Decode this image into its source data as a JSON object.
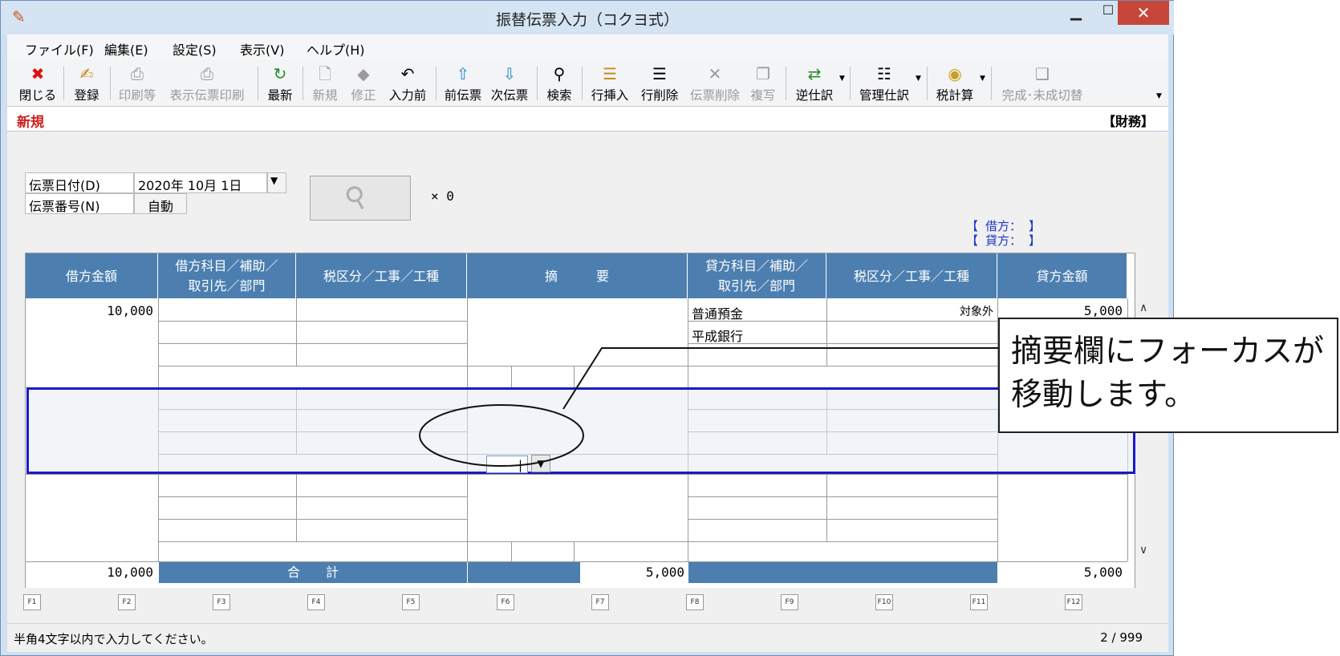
{
  "window": {
    "title": "振替伝票入力（コクヨ式）"
  },
  "menu": [
    "ファイル(F)",
    "編集(E)",
    "設定(S)",
    "表示(V)",
    "ヘルプ(H)"
  ],
  "toolbar": {
    "close": "閉じる",
    "register": "登録",
    "print": "印刷等",
    "print_display": "表示伝票印刷",
    "refresh": "最新",
    "new": "新規",
    "modify": "修正",
    "before_input": "入力前",
    "prev_slip": "前伝票",
    "next_slip": "次伝票",
    "search": "検索",
    "row_insert": "行挿入",
    "row_delete": "行削除",
    "slip_delete": "伝票削除",
    "copy": "複写",
    "reverse": "逆仕訳",
    "manage": "管理仕訳",
    "tax_calc": "税計算",
    "complete": "完成･未成切替"
  },
  "mode": {
    "status": "新規",
    "category": "【財務】"
  },
  "header": {
    "date_label": "伝票日付(D)",
    "date_value": "2020年 10月  1日",
    "number_label": "伝票番号(N)",
    "number_value": "自動",
    "attach_count": "× 0",
    "debit_summary": "【 借方：              】",
    "credit_summary": "【 貸方：              】"
  },
  "grid": {
    "headers": {
      "debit_amount": "借方金額",
      "debit_account_1": "借方科目／補助／",
      "debit_account_2": "取引先／部門",
      "debit_tax": "税区分／工事／工種",
      "summary": "摘　　　要",
      "credit_account_1": "貸方科目／補助／",
      "credit_account_2": "取引先／部門",
      "credit_tax": "税区分／工事／工種",
      "credit_amount": "貸方金額"
    },
    "row1": {
      "debit_amount": "10,000",
      "credit_account": "普通預金",
      "credit_sub": "平成銀行",
      "credit_tax": "対象外",
      "credit_amount": "5,000"
    },
    "totals": {
      "debit_total": "10,000",
      "label": "合　　計",
      "summary_total": "5,000",
      "credit_total": "5,000"
    }
  },
  "fkeys": [
    "F1",
    "F2",
    "F3",
    "F4",
    "F5",
    "F6",
    "F7",
    "F8",
    "F9",
    "F10",
    "F11",
    "F12"
  ],
  "status": {
    "message": "半角4文字以内で入力してください。",
    "page": "2 / 999"
  },
  "callout": {
    "line1": "摘要欄にフォーカスが",
    "line2": "移動します。"
  }
}
